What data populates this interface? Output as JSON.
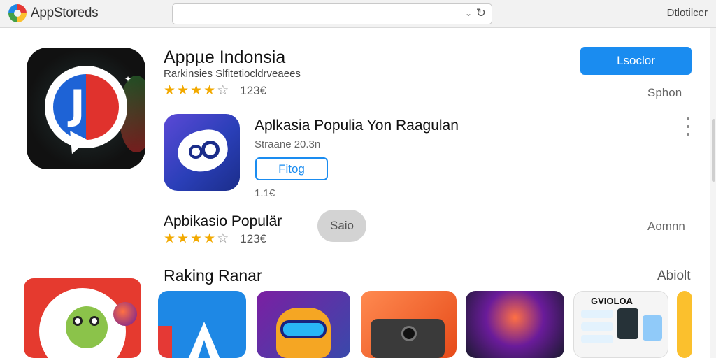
{
  "header": {
    "brand_name": "AppStoreds",
    "search": {
      "value": "",
      "placeholder": ""
    },
    "right_link": "Dtlotilcer"
  },
  "hero_app": {
    "title": "Appµe Indonsia",
    "subtitle": "Rarkinsies Slfitetiocldrveaees",
    "rating": 4.5,
    "rating_text": "123€",
    "action_label": "Lsoclor",
    "side_label": "Sphon"
  },
  "second_app": {
    "title": "Aplkasia Populia  Yon Raagulan",
    "subtitle": "Straane 20.3n",
    "button_label": "Fitog",
    "size_text": "1.1€"
  },
  "third_app": {
    "title": "Apbikasio Populär",
    "button_label": "Saio",
    "rating": 4.5,
    "rating_text": "123€",
    "side_label": "Aomnn"
  },
  "ranking": {
    "title": "Raking Ranar",
    "link_label": "Abiolt",
    "items": [
      {
        "name": "ranking-game-mascot",
        "label": ""
      },
      {
        "name": "ranking-blue-a",
        "label": ""
      },
      {
        "name": "ranking-cat-goggles",
        "label": ""
      },
      {
        "name": "ranking-phone-camera",
        "label": ""
      },
      {
        "name": "ranking-concert",
        "label": ""
      },
      {
        "name": "ranking-gvioloa",
        "label": "GVIOLOA"
      },
      {
        "name": "ranking-partial",
        "label": ""
      }
    ]
  },
  "colors": {
    "accent": "#1a8cf0",
    "star": "#f2a900",
    "topbar": "#f2f2f2"
  },
  "icons": [
    "brand-logo-icon",
    "chevron-down-icon",
    "reload-icon",
    "more-vert-icon",
    "star-icon"
  ]
}
